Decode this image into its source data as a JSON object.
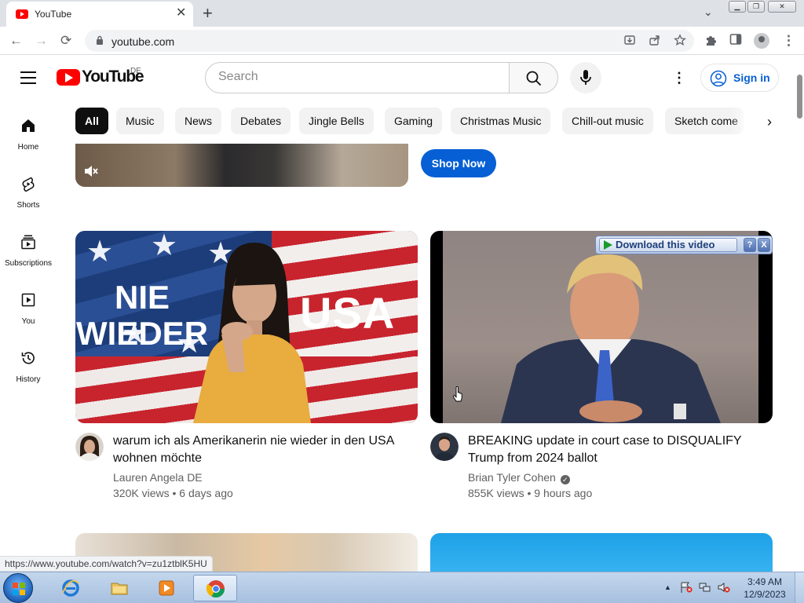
{
  "browser": {
    "tab_title": "YouTube",
    "tab_close_glyph": "✕",
    "new_tab_glyph": "+",
    "tab_search_glyph": "⌄",
    "url": "youtube.com",
    "window_buttons": {
      "minimize": "▁",
      "maximize": "❐",
      "close": "✕"
    },
    "nav": {
      "back": "←",
      "forward": "→",
      "reload": "⟳"
    }
  },
  "youtube": {
    "logo_text": "YouTube",
    "country_code": "DE",
    "search": {
      "placeholder": "Search"
    },
    "more_glyph": "⋮",
    "signin_label": "Sign in",
    "chips": [
      "All",
      "Music",
      "News",
      "Debates",
      "Jingle Bells",
      "Gaming",
      "Christmas Music",
      "Chill-out music",
      "Sketch come"
    ],
    "active_chip": "All",
    "chip_next_glyph": "›",
    "guide": [
      {
        "label": "Home",
        "icon": "home-icon"
      },
      {
        "label": "Shorts",
        "icon": "shorts-icon"
      },
      {
        "label": "Subscriptions",
        "icon": "subscriptions-icon"
      },
      {
        "label": "You",
        "icon": "you-icon"
      },
      {
        "label": "History",
        "icon": "history-icon"
      }
    ],
    "ad": {
      "cta_label": "Shop Now"
    },
    "videos": [
      {
        "title": "warum ich als Amerikanerin nie wieder in den USA wohnen möchte",
        "channel": "Lauren Angela DE",
        "verified": false,
        "views": "320K views",
        "age": "6 days ago",
        "thumbnail_text_left": "NIE WIEDER",
        "thumbnail_text_right": "USA"
      },
      {
        "title": "BREAKING update in court case to DISQUALIFY Trump from 2024 ballot",
        "channel": "Brian Tyler Cohen",
        "verified": true,
        "views": "855K views",
        "age": "9 hours ago"
      }
    ],
    "meta_separator": "•"
  },
  "download_overlay": {
    "button_label": "Download this video",
    "help_label": "?",
    "close_label": "X"
  },
  "status_bar": {
    "url": "https://www.youtube.com/watch?v=zu1ztblK5HU"
  },
  "taskbar": {
    "time": "3:49 AM",
    "date": "12/9/2023",
    "tray_arrow": "▲"
  },
  "colors": {
    "youtube_red": "#ff0000",
    "link_blue": "#065fd4",
    "chip_bg": "#f2f2f2",
    "active_chip_bg": "#0f0f0f",
    "secondary_text": "#606060"
  }
}
